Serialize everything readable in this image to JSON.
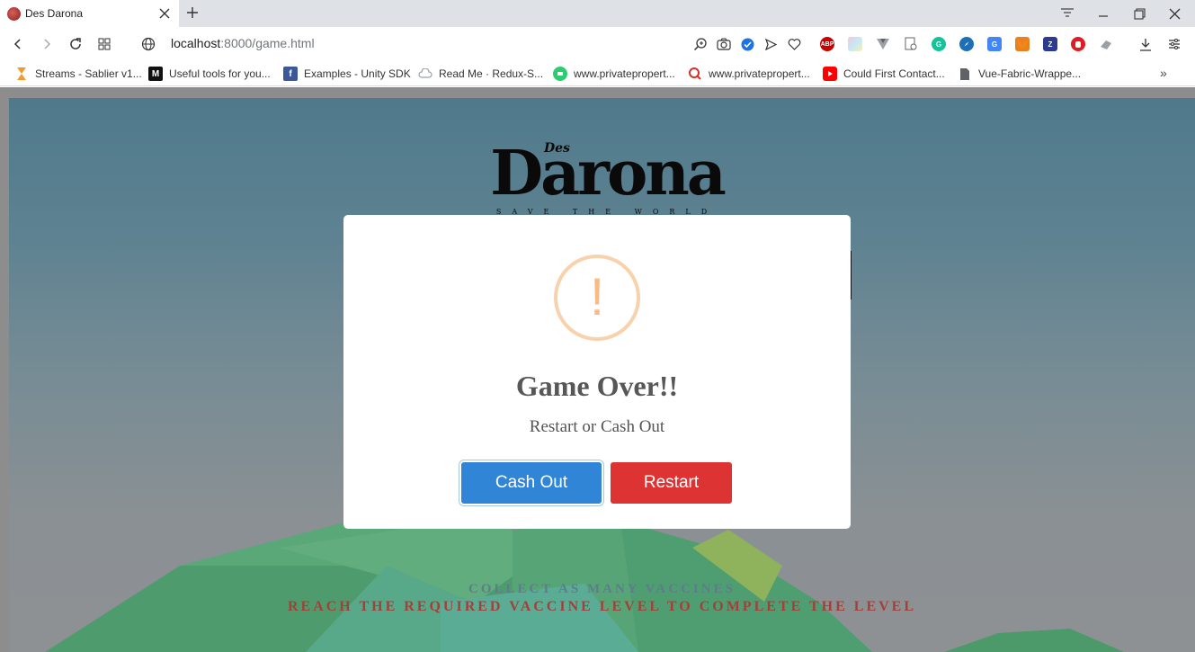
{
  "browser": {
    "tab_title": "Des Darona",
    "url_host": "localhost",
    "url_path": ":8000/game.html"
  },
  "bookmarks": [
    {
      "label": "Streams - Sablier v1...",
      "icon": "sablier-icon",
      "color": "#f29b2d"
    },
    {
      "label": "Useful tools for you...",
      "icon": "medium-icon",
      "color": "#111111"
    },
    {
      "label": "Examples - Unity SDK",
      "icon": "facebook-icon",
      "color": "#3b5998"
    },
    {
      "label": "Read Me · Redux-S...",
      "icon": "cloud-icon",
      "color": "#9aa0a6"
    },
    {
      "label": "www.privatepropert...",
      "icon": "chat-icon",
      "color": "#2ecc71"
    },
    {
      "label": "www.privatepropert...",
      "icon": "search-pin-icon",
      "color": "#d93025"
    },
    {
      "label": "Could First Contact...",
      "icon": "youtube-icon",
      "color": "#ff0000"
    },
    {
      "label": "Vue-Fabric-Wrappe...",
      "icon": "document-icon",
      "color": "#5f6368"
    }
  ],
  "game": {
    "logo_small": "Des",
    "logo_main": "Darona",
    "logo_tagline": "SAVE THE WORLD",
    "hint_collect": "COLLECT AS MANY VACCINES",
    "hint_level": "REACH THE REQUIRED VACCINE LEVEL TO COMPLETE THE LEVEL"
  },
  "modal": {
    "icon": "warning-icon",
    "icon_glyph": "!",
    "title": "Game Over!!",
    "text": "Restart or Cash Out",
    "cash_out_label": "Cash Out",
    "restart_label": "Restart"
  },
  "colors": {
    "cash_out": "#3085d6",
    "restart": "#dd3333",
    "warning": "#f8bb86"
  }
}
